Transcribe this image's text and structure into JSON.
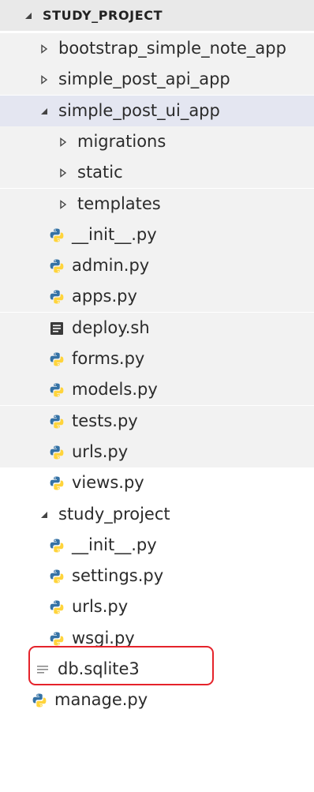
{
  "explorer": {
    "root_label": "STUDY_PROJECT",
    "items": [
      {
        "name": "bootstrap_simple_note_app",
        "kind": "folder",
        "expanded": false,
        "depth": 1
      },
      {
        "name": "simple_post_api_app",
        "kind": "folder",
        "expanded": false,
        "depth": 1
      },
      {
        "name": "simple_post_ui_app",
        "kind": "folder",
        "expanded": true,
        "depth": 1,
        "selected": true
      },
      {
        "name": "migrations",
        "kind": "folder",
        "expanded": false,
        "depth": 2
      },
      {
        "name": "static",
        "kind": "folder",
        "expanded": false,
        "depth": 2
      },
      {
        "name": "templates",
        "kind": "folder",
        "expanded": false,
        "depth": 2
      },
      {
        "name": "__init__.py",
        "kind": "python",
        "depth": 2
      },
      {
        "name": "admin.py",
        "kind": "python",
        "depth": 2
      },
      {
        "name": "apps.py",
        "kind": "python",
        "depth": 2
      },
      {
        "name": "deploy.sh",
        "kind": "shell",
        "depth": 2
      },
      {
        "name": "forms.py",
        "kind": "python",
        "depth": 2
      },
      {
        "name": "models.py",
        "kind": "python",
        "depth": 2
      },
      {
        "name": "tests.py",
        "kind": "python",
        "depth": 2
      },
      {
        "name": "urls.py",
        "kind": "python",
        "depth": 2
      },
      {
        "name": "views.py",
        "kind": "python",
        "depth": 2,
        "highlighted": true
      },
      {
        "name": "study_project",
        "kind": "folder",
        "expanded": true,
        "depth": 1
      },
      {
        "name": "__init__.py",
        "kind": "python",
        "depth": 2
      },
      {
        "name": "settings.py",
        "kind": "python",
        "depth": 2
      },
      {
        "name": "urls.py",
        "kind": "python",
        "depth": 2
      },
      {
        "name": "wsgi.py",
        "kind": "python",
        "depth": 2
      },
      {
        "name": "db.sqlite3",
        "kind": "text",
        "depth": 1
      },
      {
        "name": "manage.py",
        "kind": "python",
        "depth": 1
      }
    ]
  },
  "colors": {
    "highlight_border": "#e5232b",
    "python_blue": "#3572a5",
    "python_yellow": "#ffd43b",
    "selection_bg": "#e4e6f1"
  }
}
